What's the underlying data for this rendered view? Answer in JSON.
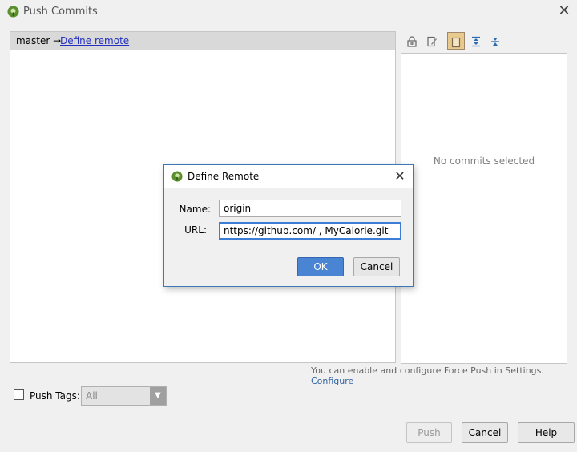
{
  "window": {
    "title": "Push Commits",
    "close_glyph": "✕"
  },
  "branch_row": {
    "branch": "master",
    "arrow": "→",
    "link_label": "Define remote"
  },
  "toolbar": [
    {
      "name": "lock-icon"
    },
    {
      "name": "edit-icon"
    },
    {
      "name": "preview-icon",
      "active": true
    },
    {
      "name": "expand-all-icon"
    },
    {
      "name": "collapse-all-icon"
    }
  ],
  "details": {
    "empty_text": "No commits selected"
  },
  "force_push_hint": {
    "text": "You can enable and configure Force Push in Settings.",
    "link": "Configure"
  },
  "push_tags": {
    "checked": false,
    "label": "Push Tags:",
    "selected": "All"
  },
  "buttons": {
    "push": "Push",
    "cancel": "Cancel",
    "help": "Help"
  },
  "dialog": {
    "title": "Define Remote",
    "close_glyph": "✕",
    "name_label": "Name:",
    "name_value": "origin",
    "url_label": "URL:",
    "url_value": "nttps://github.com/          , MyCalorie.git",
    "ok": "OK",
    "cancel": "Cancel"
  },
  "colors": {
    "accent": "#4a85d3",
    "link": "#2430c0",
    "dialog_border": "#3d76b9"
  }
}
